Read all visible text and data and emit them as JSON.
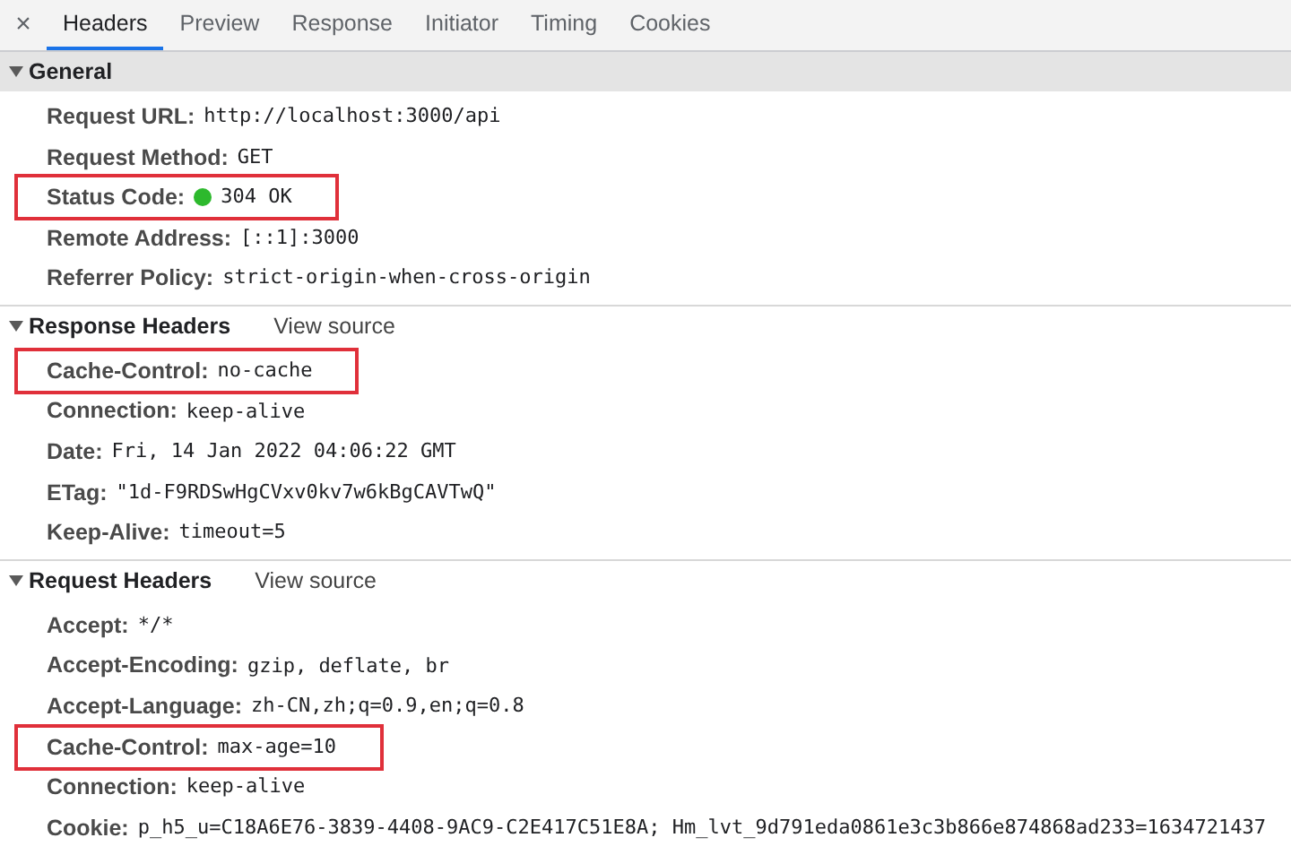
{
  "close_label": "×",
  "tabs": [
    {
      "label": "Headers",
      "selected": true
    },
    {
      "label": "Preview",
      "selected": false
    },
    {
      "label": "Response",
      "selected": false
    },
    {
      "label": "Initiator",
      "selected": false
    },
    {
      "label": "Timing",
      "selected": false
    },
    {
      "label": "Cookies",
      "selected": false
    }
  ],
  "sections": [
    {
      "title": "General",
      "expanded": true,
      "selected": true,
      "rows": [
        {
          "name": "Request URL:",
          "value": "http://localhost:3000/api",
          "highlighted": false
        },
        {
          "name": "Request Method:",
          "value": "GET",
          "highlighted": false
        },
        {
          "name": "Status Code:",
          "value": "304 OK",
          "highlighted": true,
          "color": "#2db92d"
        },
        {
          "name": "Remote Address:",
          "value": "[::1]:3000",
          "highlighted": false
        },
        {
          "name": "Referrer Policy:",
          "value": "strict-origin-when-cross-origin",
          "highlighted": false
        }
      ]
    },
    {
      "title": "Response Headers",
      "link": "View source",
      "expanded": true,
      "selected": false,
      "rows": [
        {
          "name": "Cache-Control:",
          "value": "no-cache",
          "highlighted": true
        },
        {
          "name": "Connection:",
          "value": "keep-alive",
          "highlighted": false
        },
        {
          "name": "Date:",
          "value": "Fri, 14 Jan 2022 04:06:22 GMT",
          "highlighted": false
        },
        {
          "name": "ETag:",
          "value": "\"1d-F9RDSwHgCVxv0kv7w6kBgCAVTwQ\"",
          "highlighted": false
        },
        {
          "name": "Keep-Alive:",
          "value": "timeout=5",
          "highlighted": false
        }
      ]
    },
    {
      "title": "Request Headers",
      "link": "View source",
      "expanded": true,
      "selected": false,
      "rows": [
        {
          "name": "Accept:",
          "value": "*/*",
          "highlighted": false
        },
        {
          "name": "Accept-Encoding:",
          "value": "gzip, deflate, br",
          "highlighted": false
        },
        {
          "name": "Accept-Language:",
          "value": "zh-CN,zh;q=0.9,en;q=0.8",
          "highlighted": false
        },
        {
          "name": "Cache-Control:",
          "value": "max-age=10",
          "highlighted": true
        },
        {
          "name": "Connection:",
          "value": "keep-alive",
          "highlighted": false
        },
        {
          "name": "Cookie:",
          "value": "p_h5_u=C18A6E76-3839-4408-9AC9-C2E417C51E8A; Hm_lvt_9d791eda0861e3c3b866e874868ad233=1634721437",
          "highlighted": false
        }
      ]
    }
  ]
}
